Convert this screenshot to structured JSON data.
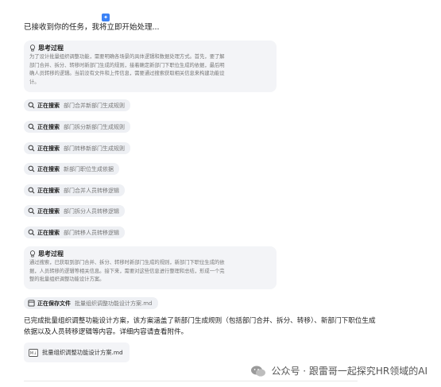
{
  "intro": "已接收到你的任务，我将立即开始处理...",
  "think1": {
    "title": "思考过程",
    "lines": [
      "为了设计批量组织调整功能，需要明确各场景的具体逻辑和数据处理方式。首先，要了解",
      "部门合并、拆分、转移时新部门生成的规则，接着确定新部门下职位生成的依据，最后明",
      "确人员转移的逻辑。当前没有文件和上传信息，需要通过搜索获取相关信息来构建功能设",
      "计。"
    ]
  },
  "searches": [
    {
      "label": "正在搜索",
      "query": "部门合并新部门生成规则"
    },
    {
      "label": "正在搜索",
      "query": "部门拆分新部门生成规则"
    },
    {
      "label": "正在搜索",
      "query": "部门转移新部门生成规则"
    },
    {
      "label": "正在搜索",
      "query": "新部门职位生成依据"
    },
    {
      "label": "正在搜索",
      "query": "部门合并人员转移逻辑"
    },
    {
      "label": "正在搜索",
      "query": "部门拆分人员转移逻辑"
    },
    {
      "label": "正在搜索",
      "query": "部门转移人员转移逻辑"
    }
  ],
  "think2": {
    "title": "思考过程",
    "lines": [
      "通过搜索，已获取到部门合并、拆分、转移时新部门生成的规则，新部门下职位生成的依",
      "据，人员转移的逻辑等相关信息。接下来，需要对这些信息进行整理和总结，形成一个完",
      "整的批量组织调整功能设计方案。"
    ]
  },
  "save": {
    "label": "正在保存文件",
    "filename": "批量组织调整功能设计方案.md"
  },
  "summary": "已完成批量组织调整功能设计方案，该方案涵盖了新部门生成规则（包括部门合并、拆分、转移）、新部门下职位生成依据以及人员转移逻辑等内容。详细内容请查看附件。",
  "file_card": {
    "name": "批量组织调整功能设计方案.md"
  },
  "watermark": "公众号 · 跟雷哥一起探究HR领域的AI"
}
